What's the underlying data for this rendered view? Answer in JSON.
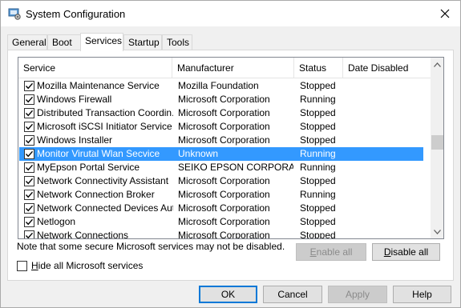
{
  "window": {
    "title": "System Configuration",
    "app_icon": "msconfig-icon",
    "close_icon": "close-icon"
  },
  "tabs": [
    {
      "label": "General",
      "active": false
    },
    {
      "label": "Boot",
      "active": false
    },
    {
      "label": "Services",
      "active": true
    },
    {
      "label": "Startup",
      "active": false
    },
    {
      "label": "Tools",
      "active": false
    }
  ],
  "services_table": {
    "columns": [
      "Service",
      "Manufacturer",
      "Status",
      "Date Disabled"
    ],
    "rows": [
      {
        "service": "Mozilla Maintenance Service",
        "manufacturer": "Mozilla Foundation",
        "status": "Stopped",
        "date_disabled": "",
        "checked": true,
        "selected": false
      },
      {
        "service": "Windows Firewall",
        "manufacturer": "Microsoft Corporation",
        "status": "Running",
        "date_disabled": "",
        "checked": true,
        "selected": false
      },
      {
        "service": "Distributed Transaction Coordin...",
        "manufacturer": "Microsoft Corporation",
        "status": "Stopped",
        "date_disabled": "",
        "checked": true,
        "selected": false
      },
      {
        "service": "Microsoft iSCSI Initiator Service",
        "manufacturer": "Microsoft Corporation",
        "status": "Stopped",
        "date_disabled": "",
        "checked": true,
        "selected": false
      },
      {
        "service": "Windows Installer",
        "manufacturer": "Microsoft Corporation",
        "status": "Stopped",
        "date_disabled": "",
        "checked": true,
        "selected": false
      },
      {
        "service": "Monitor Virutal Wlan Secvice",
        "manufacturer": "Unknown",
        "status": "Running",
        "date_disabled": "",
        "checked": true,
        "selected": true
      },
      {
        "service": "MyEpson Portal Service",
        "manufacturer": "SEIKO EPSON CORPORAT...",
        "status": "Running",
        "date_disabled": "",
        "checked": true,
        "selected": false
      },
      {
        "service": "Network Connectivity Assistant",
        "manufacturer": "Microsoft Corporation",
        "status": "Stopped",
        "date_disabled": "",
        "checked": true,
        "selected": false
      },
      {
        "service": "Network Connection Broker",
        "manufacturer": "Microsoft Corporation",
        "status": "Running",
        "date_disabled": "",
        "checked": true,
        "selected": false
      },
      {
        "service": "Network Connected Devices Aut...",
        "manufacturer": "Microsoft Corporation",
        "status": "Stopped",
        "date_disabled": "",
        "checked": true,
        "selected": false
      },
      {
        "service": "Netlogon",
        "manufacturer": "Microsoft Corporation",
        "status": "Stopped",
        "date_disabled": "",
        "checked": true,
        "selected": false
      },
      {
        "service": "Network Connections",
        "manufacturer": "Microsoft Corporation",
        "status": "Stopped",
        "date_disabled": "",
        "checked": true,
        "selected": false
      }
    ]
  },
  "note": "Note that some secure Microsoft services may not be disabled.",
  "enable_all": {
    "label_u": "E",
    "label_rest": "nable all",
    "enabled": false
  },
  "disable_all": {
    "label_u": "D",
    "label_rest": "isable all",
    "enabled": true
  },
  "hide_ms": {
    "label_u": "H",
    "label_rest": "ide all Microsoft services",
    "checked": false
  },
  "dialog_buttons": {
    "ok": "OK",
    "cancel": "Cancel",
    "apply": "Apply",
    "help": "Help"
  },
  "colors": {
    "selection": "#3399ff",
    "default_button_border": "#0078d7"
  }
}
